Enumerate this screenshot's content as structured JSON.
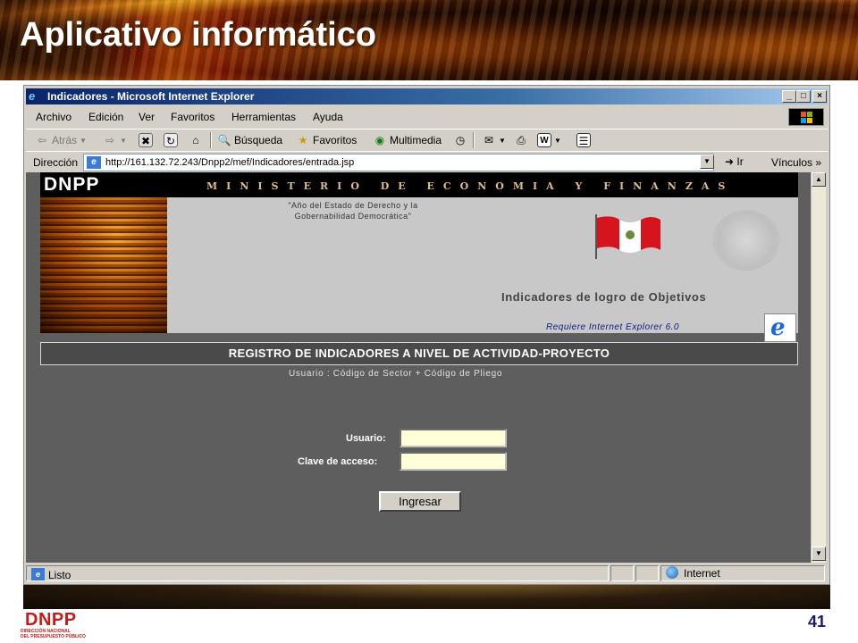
{
  "slide": {
    "title": "Aplicativo informático",
    "page_number": "41",
    "footer_logo": {
      "name": "DNPP",
      "subtitle_line1": "DIRECCIÓN NACIONAL",
      "subtitle_line2": "DEL PRESUPUESTO PÚBLICO"
    }
  },
  "browser": {
    "window_title": "Indicadores - Microsoft Internet Explorer",
    "window_buttons": [
      "_",
      "□",
      "×"
    ],
    "menu": [
      "Archivo",
      "Edición",
      "Ver",
      "Favoritos",
      "Herramientas",
      "Ayuda"
    ],
    "toolbar": {
      "back": "Atrás",
      "search": "Búsqueda",
      "favorites": "Favoritos",
      "multimedia": "Multimedia"
    },
    "address_label": "Dirección",
    "address_url": "http://161.132.72.243/Dnpp2/mef/Indicadores/entrada.jsp",
    "go_label": "Ir",
    "links_label": "Vínculos",
    "status_text": "Listo",
    "zone_text": "Internet"
  },
  "page": {
    "logo": "DNPP",
    "ministry": "MINISTERIO DE ECONOMIA Y FINANZAS",
    "slogan_line1": "\"Año del Estado de Derecho y la",
    "slogan_line2": "Gobernabilidad Democrática\"",
    "indicators_title": "Indicadores de logro de Objetivos",
    "requires": "Requiere Internet Explorer 6.0",
    "register_banner": "REGISTRO DE INDICADORES A NIVEL DE ACTIVIDAD-PROYECTO",
    "user_hint": "Usuario : Código de Sector + Código de Pliego",
    "form": {
      "user_label": "Usuario:",
      "user_value": "",
      "password_label": "Clave de acceso:",
      "password_value": "",
      "submit_label": "Ingresar"
    }
  },
  "colors": {
    "page_background": "#5e5e5e",
    "input_background": "#ffffd8",
    "titlebar": "#0a246a",
    "footer_logo": "#c41a1a"
  }
}
